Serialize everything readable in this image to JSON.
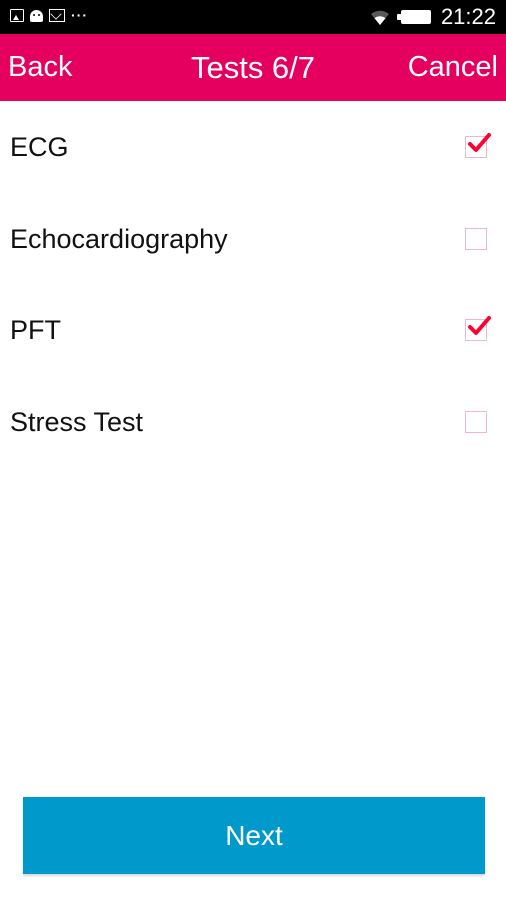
{
  "status_bar": {
    "time": "21:22",
    "left_icons": [
      "image-icon",
      "android-icon",
      "mail-icon",
      "more-dots-icon"
    ],
    "more_glyph": "···",
    "right_icons": [
      "wifi-icon",
      "battery-icon"
    ]
  },
  "nav": {
    "back_label": "Back",
    "title": "Tests 6/7",
    "cancel_label": "Cancel",
    "color": "#e5005f"
  },
  "tests": [
    {
      "label": "ECG",
      "checked": true
    },
    {
      "label": "Echocardiography",
      "checked": false
    },
    {
      "label": "PFT",
      "checked": true
    },
    {
      "label": "Stress Test",
      "checked": false
    }
  ],
  "next_label": "Next",
  "colors": {
    "accent": "#e5005f",
    "button": "#0099cc",
    "checkmark": "#ff0033"
  }
}
